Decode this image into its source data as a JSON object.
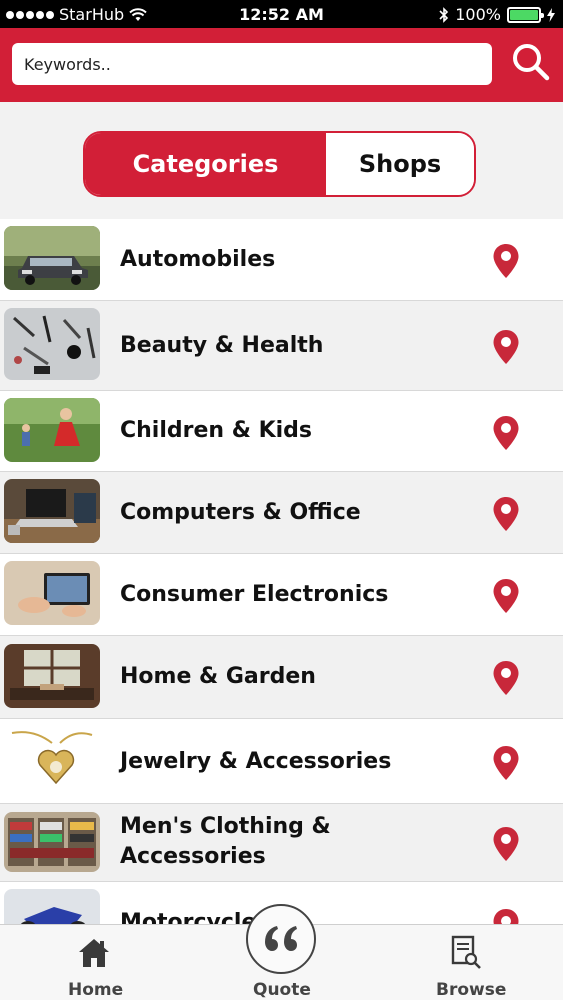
{
  "status_bar": {
    "carrier": "StarHub",
    "time": "12:52 AM",
    "battery": "100%",
    "battery_level": 1.0
  },
  "search": {
    "placeholder": "Keywords.."
  },
  "segments": {
    "categories": "Categories",
    "shops": "Shops",
    "selected": "Categories"
  },
  "categories": [
    {
      "label": "Automobiles",
      "image": "car-photo"
    },
    {
      "label": "Beauty & Health",
      "image": "makeup-tools-photo"
    },
    {
      "label": "Children & Kids",
      "image": "child-red-dress-photo"
    },
    {
      "label": "Computers & Office",
      "image": "laptop-desk-photo"
    },
    {
      "label": "Consumer Electronics",
      "image": "tablet-hands-photo"
    },
    {
      "label": "Home & Garden",
      "image": "room-window-photo"
    },
    {
      "label": "Jewelry & Accessories",
      "image": "heart-locket-photo"
    },
    {
      "label": "Men's Clothing & Accessories",
      "label_line1": "Men's Clothing &",
      "label_line2": "Accessories",
      "image": "clothing-shelves-photo"
    },
    {
      "label": "Motorcycles",
      "image": "motorcycle-photo"
    }
  ],
  "tabs": {
    "home": "Home",
    "quote": "Quote",
    "browse": "Browse"
  },
  "colors": {
    "brand_red": "#d21f37",
    "pin_red": "#c8283a"
  }
}
